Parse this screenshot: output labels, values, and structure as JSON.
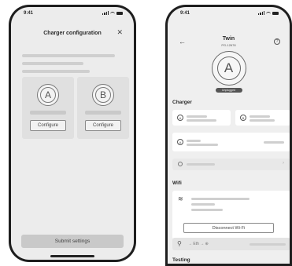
{
  "left_phone": {
    "status": {
      "time": "9:41"
    },
    "title": "Charger configuration",
    "chargers": [
      {
        "letter": "A",
        "button": "Configure"
      },
      {
        "letter": "B",
        "button": "Configure"
      }
    ],
    "submit_label": "Submit settings"
  },
  "right_phone": {
    "status": {
      "time": "9:41"
    },
    "device_name": "Twin",
    "device_id": "PG-12678",
    "letter": "A",
    "badge": "Unplugged",
    "sections": {
      "charger": "Charger",
      "wifi": "Wifi",
      "testing": "Testing"
    },
    "disconnect_label": "Disconnect Wi-Fi",
    "flow_text": "Eth"
  },
  "colors": {
    "frame": "#1e1e1e",
    "screen": "#ececec",
    "placeholder": "#cfcfcf",
    "card": "#e0e0e0"
  }
}
